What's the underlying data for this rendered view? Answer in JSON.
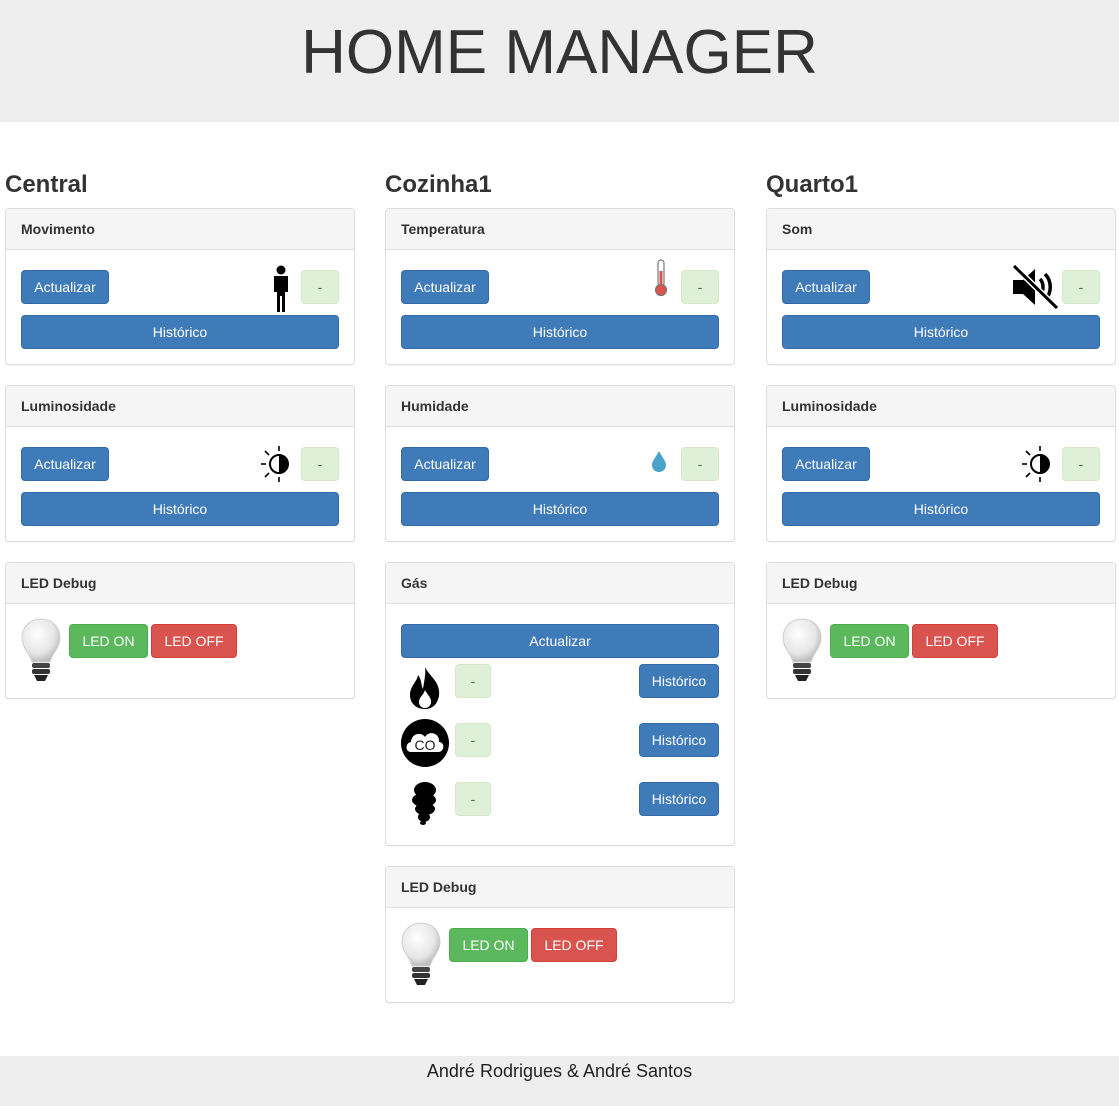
{
  "header": {
    "title": "HOME MANAGER"
  },
  "common": {
    "update_label": "Actualizar",
    "history_label": "Histórico",
    "value_placeholder": "-",
    "led_on_label": "LED ON",
    "led_off_label": "LED OFF"
  },
  "columns": [
    {
      "title": "Central",
      "panels": [
        {
          "heading": "Movimento",
          "icon": "person-icon",
          "value": "-"
        },
        {
          "heading": "Luminosidade",
          "icon": "brightness-icon",
          "value": "-"
        },
        {
          "heading": "LED Debug",
          "icon": "lightbulb-icon"
        }
      ]
    },
    {
      "title": "Cozinha1",
      "panels": [
        {
          "heading": "Temperatura",
          "icon": "thermometer-icon",
          "value": "-"
        },
        {
          "heading": "Humidade",
          "icon": "water-drop-icon",
          "value": "-"
        },
        {
          "heading": "Gás",
          "gases": [
            {
              "icon": "flame-icon",
              "value": "-"
            },
            {
              "icon": "co-cloud-icon",
              "value": "-",
              "icon_text": "CO"
            },
            {
              "icon": "smoke-icon",
              "value": "-"
            }
          ]
        },
        {
          "heading": "LED Debug",
          "icon": "lightbulb-icon"
        }
      ]
    },
    {
      "title": "Quarto1",
      "panels": [
        {
          "heading": "Som",
          "icon": "sound-muted-icon",
          "value": "-"
        },
        {
          "heading": "Luminosidade",
          "icon": "brightness-icon",
          "value": "-"
        },
        {
          "heading": "LED Debug",
          "icon": "lightbulb-icon"
        }
      ]
    }
  ],
  "colors": {
    "primary": "#3f7ab9",
    "success": "#5cb85c",
    "danger": "#d9534f",
    "value_bg": "#dff0d8"
  },
  "footer": {
    "text": "André Rodrigues & André Santos"
  }
}
